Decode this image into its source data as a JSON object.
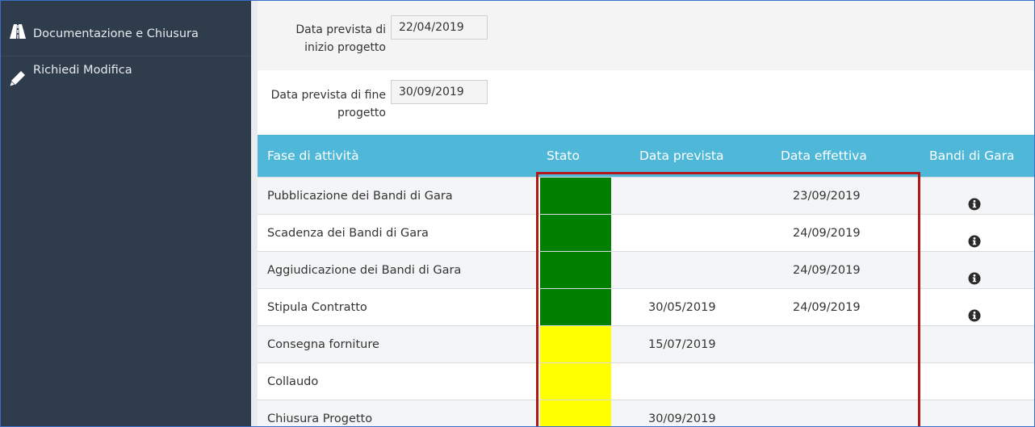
{
  "sidebar": {
    "items": [
      {
        "label": "Documentazione e Chiusura",
        "icon": "road-icon"
      },
      {
        "label": "Richiedi Modifica",
        "icon": "pencil-icon"
      }
    ]
  },
  "form": {
    "start": {
      "label_line1": "Data prevista di",
      "label_line2": "inizio progetto",
      "value": "22/04/2019"
    },
    "end": {
      "label_line1": "Data prevista di fine",
      "label_line2": "progetto",
      "value": "30/09/2019"
    }
  },
  "table": {
    "headers": [
      "Fase di attività",
      "Stato",
      "Data prevista",
      "Data effettiva",
      "Bandi di Gara"
    ],
    "rows": [
      {
        "fase": "Pubblicazione dei Bandi di Gara",
        "stato_color": "#007f00",
        "prevista": "",
        "effettiva": "23/09/2019",
        "info": true
      },
      {
        "fase": "Scadenza dei Bandi di Gara",
        "stato_color": "#007f00",
        "prevista": "",
        "effettiva": "24/09/2019",
        "info": true
      },
      {
        "fase": "Aggiudicazione dei Bandi di Gara",
        "stato_color": "#007f00",
        "prevista": "",
        "effettiva": "24/09/2019",
        "info": true
      },
      {
        "fase": "Stipula Contratto",
        "stato_color": "#007f00",
        "prevista": "30/05/2019",
        "effettiva": "24/09/2019",
        "info": true
      },
      {
        "fase": "Consegna forniture",
        "stato_color": "#ffff00",
        "prevista": "15/07/2019",
        "effettiva": "",
        "info": false
      },
      {
        "fase": "Collaudo",
        "stato_color": "#ffff00",
        "prevista": "",
        "effettiva": "",
        "info": false
      },
      {
        "fase": "Chiusura Progetto",
        "stato_color": "#ffff00",
        "prevista": "30/09/2019",
        "effettiva": "",
        "info": false
      }
    ]
  },
  "colors": {
    "header_bg": "#4fb8d8",
    "sidebar_bg": "#2f3c4b",
    "highlight": "#b01818"
  }
}
